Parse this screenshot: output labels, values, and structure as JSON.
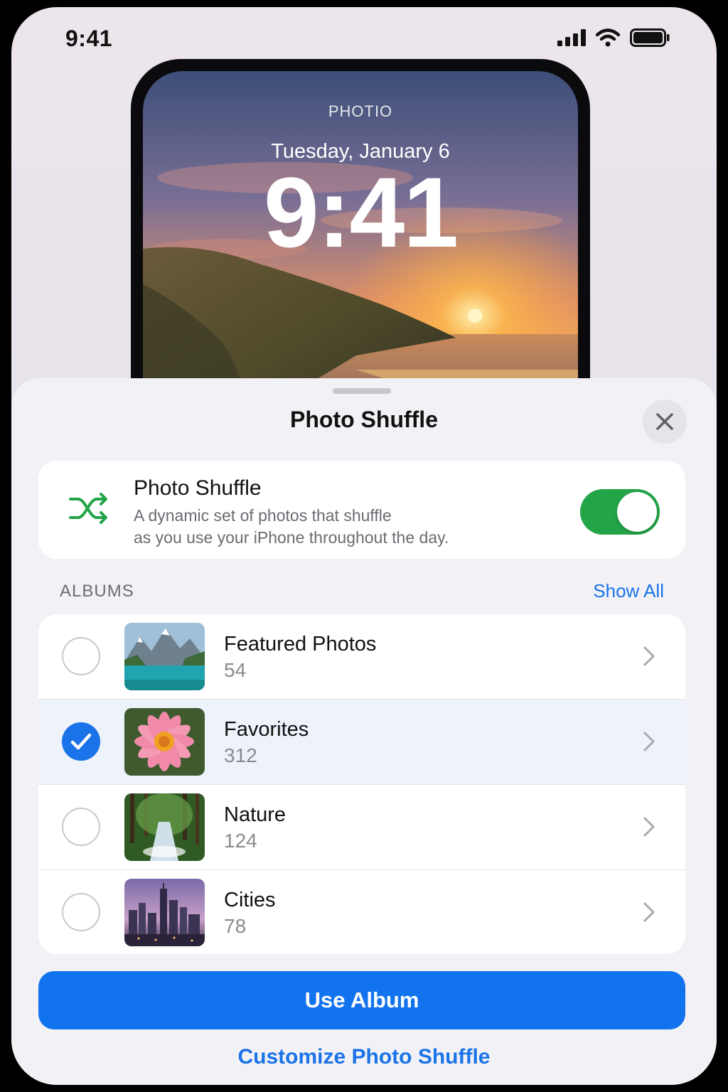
{
  "status_bar": {
    "time": "9:41",
    "icons": [
      "cellular-signal-icon",
      "wifi-icon",
      "battery-icon"
    ]
  },
  "lock_preview": {
    "label": "PHOTIO",
    "date": "Tuesday, January 6",
    "time": "9:41"
  },
  "sheet": {
    "title": "Photo Shuffle",
    "close_icon": "close-icon"
  },
  "shuffle": {
    "icon": "shuffle-icon",
    "title": "Photo Shuffle",
    "description_line1": "A dynamic set of photos that shuffle",
    "description_line2": "as you use your iPhone throughout the day.",
    "enabled": true
  },
  "albums": {
    "header": "ALBUMS",
    "show_all": "Show All",
    "items": [
      {
        "name": "Featured Photos",
        "count": "54",
        "selected": false,
        "thumb": "mountain-lake"
      },
      {
        "name": "Favorites",
        "count": "312",
        "selected": true,
        "thumb": "pink-flower"
      },
      {
        "name": "Nature",
        "count": "124",
        "selected": false,
        "thumb": "forest-stream"
      },
      {
        "name": "Cities",
        "count": "78",
        "selected": false,
        "thumb": "city-skyline"
      }
    ]
  },
  "actions": {
    "primary": "Use Album",
    "secondary": "Customize Photo Shuffle"
  },
  "colors": {
    "accent": "#1273ee",
    "toggle_on": "#22a447",
    "shuffle_icon": "#22a447"
  }
}
